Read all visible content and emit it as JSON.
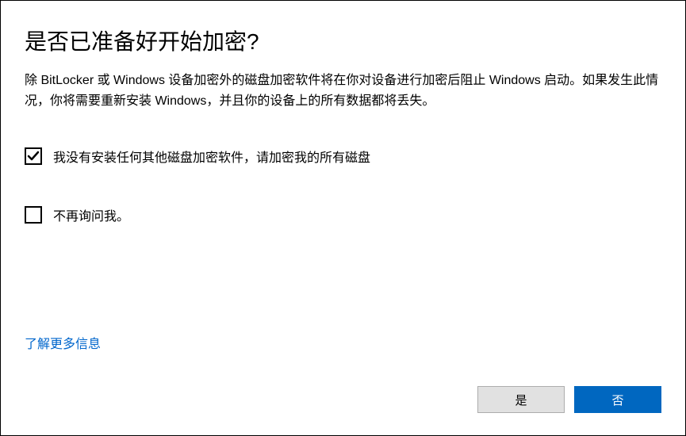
{
  "title": "是否已准备好开始加密?",
  "description": "除 BitLocker 或 Windows 设备加密外的磁盘加密软件将在你对设备进行加密后阻止 Windows 启动。如果发生此情况，你将需要重新安装 Windows，并且你的设备上的所有数据都将丢失。",
  "checkboxes": {
    "confirm": {
      "label": "我没有安装任何其他磁盘加密软件，请加密我的所有磁盘",
      "checked": true
    },
    "dontask": {
      "label": "不再询问我。",
      "checked": false
    }
  },
  "link": {
    "label": "了解更多信息"
  },
  "buttons": {
    "yes": "是",
    "no": "否"
  }
}
